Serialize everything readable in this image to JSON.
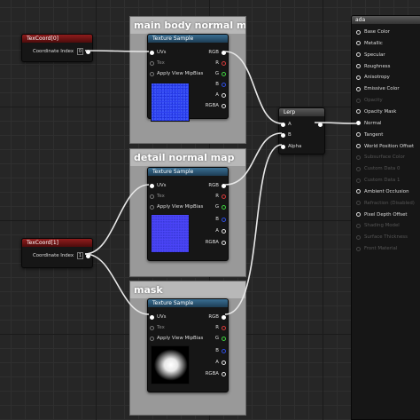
{
  "comments": {
    "main": "main body normal map",
    "detail": "detail normal map",
    "mask": "mask"
  },
  "texcoord0": {
    "title": "TexCoord[0]",
    "pin_label": "Coordinate Index",
    "value": "0"
  },
  "texcoord1": {
    "title": "TexCoord[1]",
    "pin_label": "Coordinate Index",
    "value": "1"
  },
  "texture_sample": {
    "title": "Texture Sample",
    "inputs": [
      "UVs",
      "Tex",
      "Apply View MipBias"
    ],
    "outputs": [
      "RGB",
      "R",
      "G",
      "B",
      "A",
      "RGBA"
    ]
  },
  "lerp": {
    "title": "Lerp",
    "inputs": [
      "A",
      "B",
      "Alpha"
    ]
  },
  "result": {
    "title": "ada",
    "pins": [
      {
        "label": "Base Color",
        "state": "on"
      },
      {
        "label": "Metallic",
        "state": "on"
      },
      {
        "label": "Specular",
        "state": "on"
      },
      {
        "label": "Roughness",
        "state": "on"
      },
      {
        "label": "Anisotropy",
        "state": "on"
      },
      {
        "label": "Emissive Color",
        "state": "on"
      },
      {
        "label": "Opacity",
        "state": "off"
      },
      {
        "label": "Opacity Mask",
        "state": "on"
      },
      {
        "label": "Normal",
        "state": "linked"
      },
      {
        "label": "Tangent",
        "state": "on"
      },
      {
        "label": "World Position Offset",
        "state": "on"
      },
      {
        "label": "Subsurface Color",
        "state": "off"
      },
      {
        "label": "Custom Data 0",
        "state": "off"
      },
      {
        "label": "Custom Data 1",
        "state": "off"
      },
      {
        "label": "Ambient Occlusion",
        "state": "on"
      },
      {
        "label": "Refraction (Disabled)",
        "state": "off"
      },
      {
        "label": "Pixel Depth Offset",
        "state": "on"
      },
      {
        "label": "Shading Model",
        "state": "off"
      },
      {
        "label": "Surface Thickness",
        "state": "off"
      },
      {
        "label": "Front Material",
        "state": "off"
      }
    ]
  },
  "colors": {
    "wire": "#e8e8e8",
    "texture_header": "#2f5f80",
    "texcoord_header": "#8f1c1c",
    "comment_body": "#999999"
  }
}
